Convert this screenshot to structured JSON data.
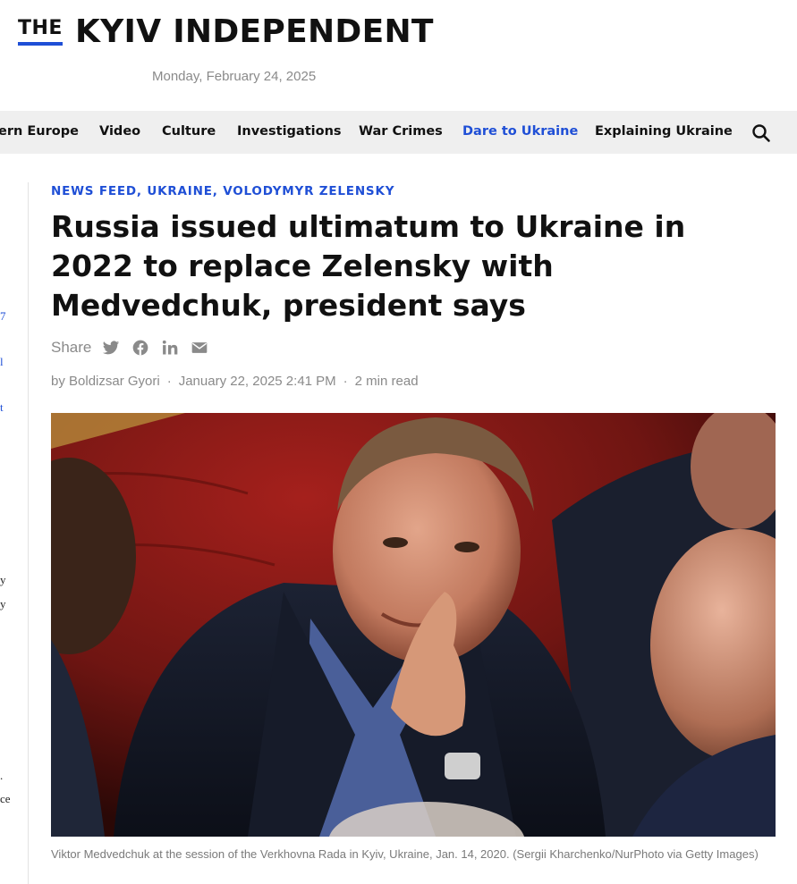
{
  "site": {
    "logo_the": "THE",
    "logo_name": "KYIV INDEPENDENT",
    "date": "Monday, February 24, 2025",
    "accent_color": "#1f4fd6"
  },
  "nav": {
    "items": [
      {
        "label": "ern Europe",
        "active": false
      },
      {
        "label": "Video",
        "active": false
      },
      {
        "label": "Culture",
        "active": false
      },
      {
        "label": "Investigations",
        "active": false
      },
      {
        "label": "War Crimes",
        "active": false
      },
      {
        "label": "Dare to Ukraine",
        "active": true
      },
      {
        "label": "Explaining Ukraine",
        "active": false
      }
    ],
    "search_icon": "search-icon"
  },
  "sidebar": {
    "fragments": [
      "7",
      "l",
      "t",
      "y",
      "y",
      ".",
      "ce"
    ]
  },
  "article": {
    "tags": [
      "NEWS FEED",
      "UKRAINE",
      "VOLODYMYR ZELENSKY"
    ],
    "headline": "Russia issued ultimatum to Ukraine in 2022 to replace Zelensky with Medvedchuk, president says",
    "share": {
      "label": "Share",
      "icons": [
        "twitter-icon",
        "facebook-icon",
        "linkedin-icon",
        "email-icon"
      ]
    },
    "byline": {
      "author": "by Boldizsar Gyori",
      "date": "January 22, 2025 2:41 PM",
      "read_time": "2 min read",
      "separator": "·"
    },
    "image": {
      "caption": "Viktor Medvedchuk at the session of the Verkhovna Rada in Kyiv, Ukraine, Jan. 14, 2020. (Sergii Kharchenko/NurPhoto via Getty Images)"
    }
  }
}
